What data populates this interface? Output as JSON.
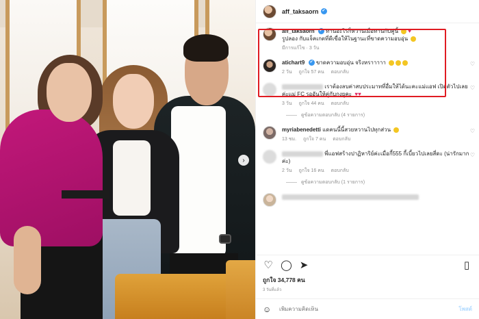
{
  "header": {
    "username": "aff_taksaorn",
    "verified_mark": "✔"
  },
  "caption": {
    "username": "aff_taksaorn",
    "text_line1": "ทานอะไรก็หวานเมื่อทานกับคู่นี้",
    "text_line2": "รูปลอง กับแจ็คเกตที่ดีเขื่อให้ไนฐานะที่ขาดความอบอุ่น",
    "edited": "มีการแก้ไข · 3 วัน"
  },
  "comments": [
    {
      "username": "atichart9",
      "text": "ขาดความอบอุ่น จริงหราาาาา",
      "time": "2 วัน",
      "likes": "ถูกใจ 57 คน",
      "reply": "ตอบกลับ"
    },
    {
      "username": "",
      "text": "เราต้องลบค่าสบประมาทที่อื่มให้ได้นะคะแม่แอฟ เปิดตัวไปเลยค่ะแม่ FC รออันให้คู่กับกงยูคะ",
      "time": "3 วัน",
      "likes": "ถูกใจ 44 คน",
      "reply": "ตอบกลับ"
    },
    {
      "username": "myriabenedetti",
      "text": "แดคนนี้นี้สวยหวานไปทุกส่วน",
      "time": "13 ชม.",
      "likes": "ถูกใจ 7 คน",
      "reply": "ตอบกลับ"
    },
    {
      "username": "",
      "text": "พี่แอฟสร้างปาฏิหาริย์ค่ะเมื่อกี้555 กี้เบี้ยวไปเลยสี่ดะ (น่ารักมากค่ะ)",
      "time": "2 วัน",
      "likes": "ถูกใจ 16 คน",
      "reply": "ตอบกลับ"
    }
  ],
  "view_replies_1": "ดูข้อความตอบกลับ (4 รายการ)",
  "view_replies_2": "ดูข้อความตอบกลับ (1 รายการ)",
  "likes": "ถูกใจ 34,778 คน",
  "posted": "3 วันที่แล้ว",
  "add_comment": {
    "placeholder": "เพิ่มความคิดเห็น",
    "post": "โพสต์"
  },
  "icons": {
    "heart": "♡",
    "comment": "◯",
    "share": "➤",
    "save": "▯",
    "emoji": "☺",
    "next": "›"
  }
}
